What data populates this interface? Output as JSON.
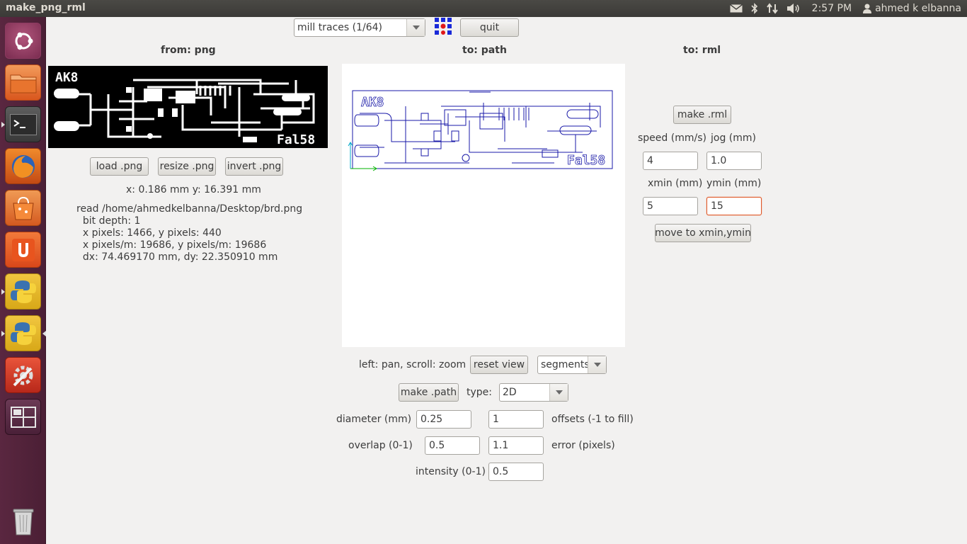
{
  "window": {
    "title": "make_png_rml"
  },
  "tray": {
    "time": "2:57 PM",
    "user": "ahmed k elbanna",
    "icons": [
      "mail-icon",
      "bluetooth-icon",
      "network-icon",
      "volume-icon",
      "user-icon"
    ]
  },
  "launcher": {
    "items": [
      "ubuntu-dash-icon",
      "files-icon",
      "terminal-icon",
      "firefox-icon",
      "software-center-icon",
      "ubuntu-one-icon",
      "python-icon",
      "python-icon",
      "system-settings-icon",
      "workspace-switcher-icon",
      "trash-icon"
    ]
  },
  "toolbar": {
    "mode": "mill traces (1/64)",
    "quit_label": "quit"
  },
  "png_panel": {
    "heading": "from: png",
    "board_label_left": "AK8",
    "board_label_right": "Fal58",
    "load_label": "load .png",
    "resize_label": "resize .png",
    "invert_label": "invert .png",
    "coords": "x: 0.186 mm  y: 16.391 mm",
    "info_lines": [
      "read /home/ahmedkelbanna/Desktop/brd.png",
      "  bit depth: 1",
      "  x pixels: 1466, y pixels: 440",
      "  x pixels/m: 19686, y pixels/m: 19686",
      "  dx: 74.469170 mm, dy: 22.350910 mm"
    ]
  },
  "path_panel": {
    "heading": "to: path",
    "board_label_left": "AK8",
    "board_label_right": "Fal58",
    "nav_hint": "left: pan, scroll: zoom",
    "reset_view_label": "reset view",
    "display_mode": "segments",
    "make_path_label": "make .path",
    "type_label": "type:",
    "type_value": "2D",
    "diameter_label": "diameter (mm)",
    "diameter_value": "0.25",
    "offsets_value": "1",
    "offsets_label": "offsets (-1 to fill)",
    "overlap_label": "overlap (0-1)",
    "overlap_value": "0.5",
    "error_value": "1.1",
    "error_label": "error (pixels)",
    "intensity_label": "intensity (0-1)",
    "intensity_value": "0.5"
  },
  "rml_panel": {
    "heading": "to: rml",
    "make_rml_label": "make .rml",
    "speed_label": "speed (mm/s)",
    "speed_value": "4",
    "jog_label": "jog (mm)",
    "jog_value": "1.0",
    "xmin_label": "xmin (mm)",
    "xmin_value": "5",
    "ymin_label": "ymin (mm)",
    "ymin_value": "15",
    "move_label": "move to xmin,ymin"
  },
  "colors": {
    "path_stroke": "#1a1aa8",
    "axis_x": "#00b000",
    "axis_y": "#00a8c8",
    "focus_border": "#e05a2a"
  }
}
